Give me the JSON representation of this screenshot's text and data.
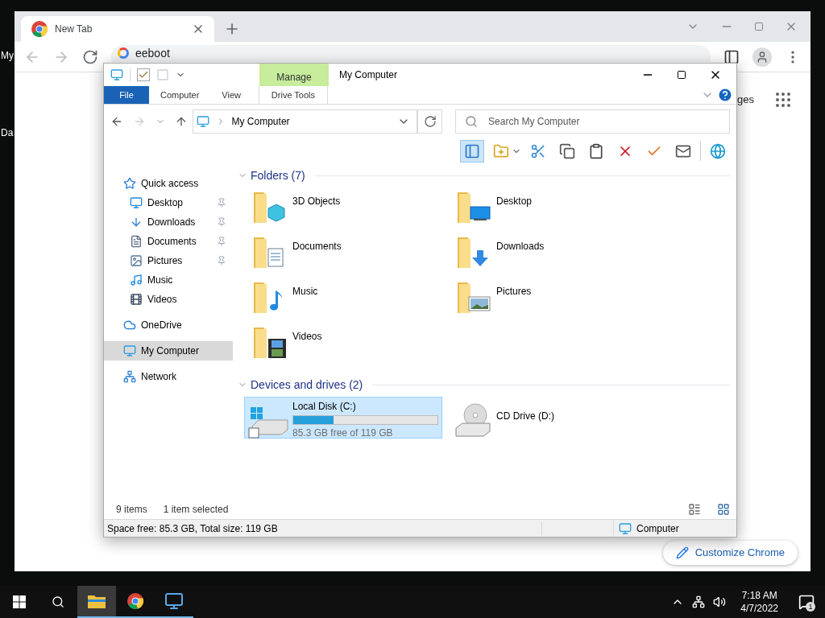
{
  "desktop": {
    "icon_labels": [
      "My",
      "Da"
    ]
  },
  "browser": {
    "tabs": [
      {
        "title": "New Tab",
        "selected": true
      }
    ],
    "address": "eeboot",
    "page_text": "ges",
    "customize_button": "Customize Chrome"
  },
  "explorer": {
    "title": "My Computer",
    "contextual_group": "Manage",
    "ribbon_tabs": [
      {
        "label": "File",
        "kind": "file"
      },
      {
        "label": "Computer",
        "kind": "tab"
      },
      {
        "label": "View",
        "kind": "tab"
      },
      {
        "label": "Drive Tools",
        "kind": "contextual"
      }
    ],
    "breadcrumb": "My Computer",
    "search": {
      "placeholder": "Search My Computer"
    },
    "toolbar": [
      {
        "kind": "pane",
        "selected": true
      },
      {
        "kind": "folder",
        "selected": false
      },
      {
        "kind": "cut",
        "selected": false
      },
      {
        "kind": "copy",
        "selected": false
      },
      {
        "kind": "paste",
        "selected": false
      },
      {
        "kind": "delete",
        "selected": false
      },
      {
        "kind": "confirm",
        "selected": false
      },
      {
        "kind": "mail",
        "selected": false
      },
      {
        "kind": "globe",
        "selected": false
      }
    ],
    "nav": [
      {
        "label": "Quick access",
        "kind": "star",
        "selected": false,
        "children": [
          {
            "label": "Desktop",
            "kind": "desktop",
            "pinned": true,
            "selected": false
          },
          {
            "label": "Downloads",
            "kind": "downloads",
            "pinned": true,
            "selected": false
          },
          {
            "label": "Documents",
            "kind": "documents",
            "pinned": true,
            "selected": false
          },
          {
            "label": "Pictures",
            "kind": "pictures",
            "pinned": true,
            "selected": false
          },
          {
            "label": "Music",
            "kind": "music",
            "pinned": false,
            "selected": false
          },
          {
            "label": "Videos",
            "kind": "videos",
            "pinned": false,
            "selected": false
          }
        ]
      },
      {
        "label": "OneDrive",
        "kind": "cloud",
        "selected": false
      },
      {
        "label": "My Computer",
        "kind": "computer",
        "selected": true
      },
      {
        "label": "Network",
        "kind": "network",
        "selected": false
      }
    ],
    "sections": [
      {
        "title": "Folders (7)",
        "expanded": true,
        "items": [
          {
            "name": "3D Objects",
            "kind": "cube"
          },
          {
            "name": "Desktop",
            "kind": "desktop"
          },
          {
            "name": "Documents",
            "kind": "documents"
          },
          {
            "name": "Downloads",
            "kind": "downloads"
          },
          {
            "name": "Music",
            "kind": "music"
          },
          {
            "name": "Pictures",
            "kind": "pictures"
          },
          {
            "name": "Videos",
            "kind": "videos"
          }
        ]
      },
      {
        "title": "Devices and drives (2)",
        "expanded": true,
        "items": [
          {
            "name": "Local Disk (C:)",
            "kind": "disk",
            "selected": true,
            "level": 0.28,
            "reading": "85.3 GB free of 119 GB"
          },
          {
            "name": "CD Drive (D:)",
            "kind": "cd",
            "selected": false
          }
        ]
      }
    ],
    "status": {
      "count": "9 items",
      "selection": "1 item selected"
    },
    "details": {
      "info": "Space free: 85.3 GB, Total size: 119 GB",
      "location": "Computer"
    }
  },
  "taskbar": {
    "apps": [
      {
        "kind": "explorer",
        "running": true,
        "active": true
      },
      {
        "kind": "chrome",
        "running": true,
        "active": false
      },
      {
        "kind": "remote",
        "running": true,
        "active": false
      }
    ],
    "time": "7:18 AM",
    "date": "4/7/2022",
    "notifications": "1"
  }
}
